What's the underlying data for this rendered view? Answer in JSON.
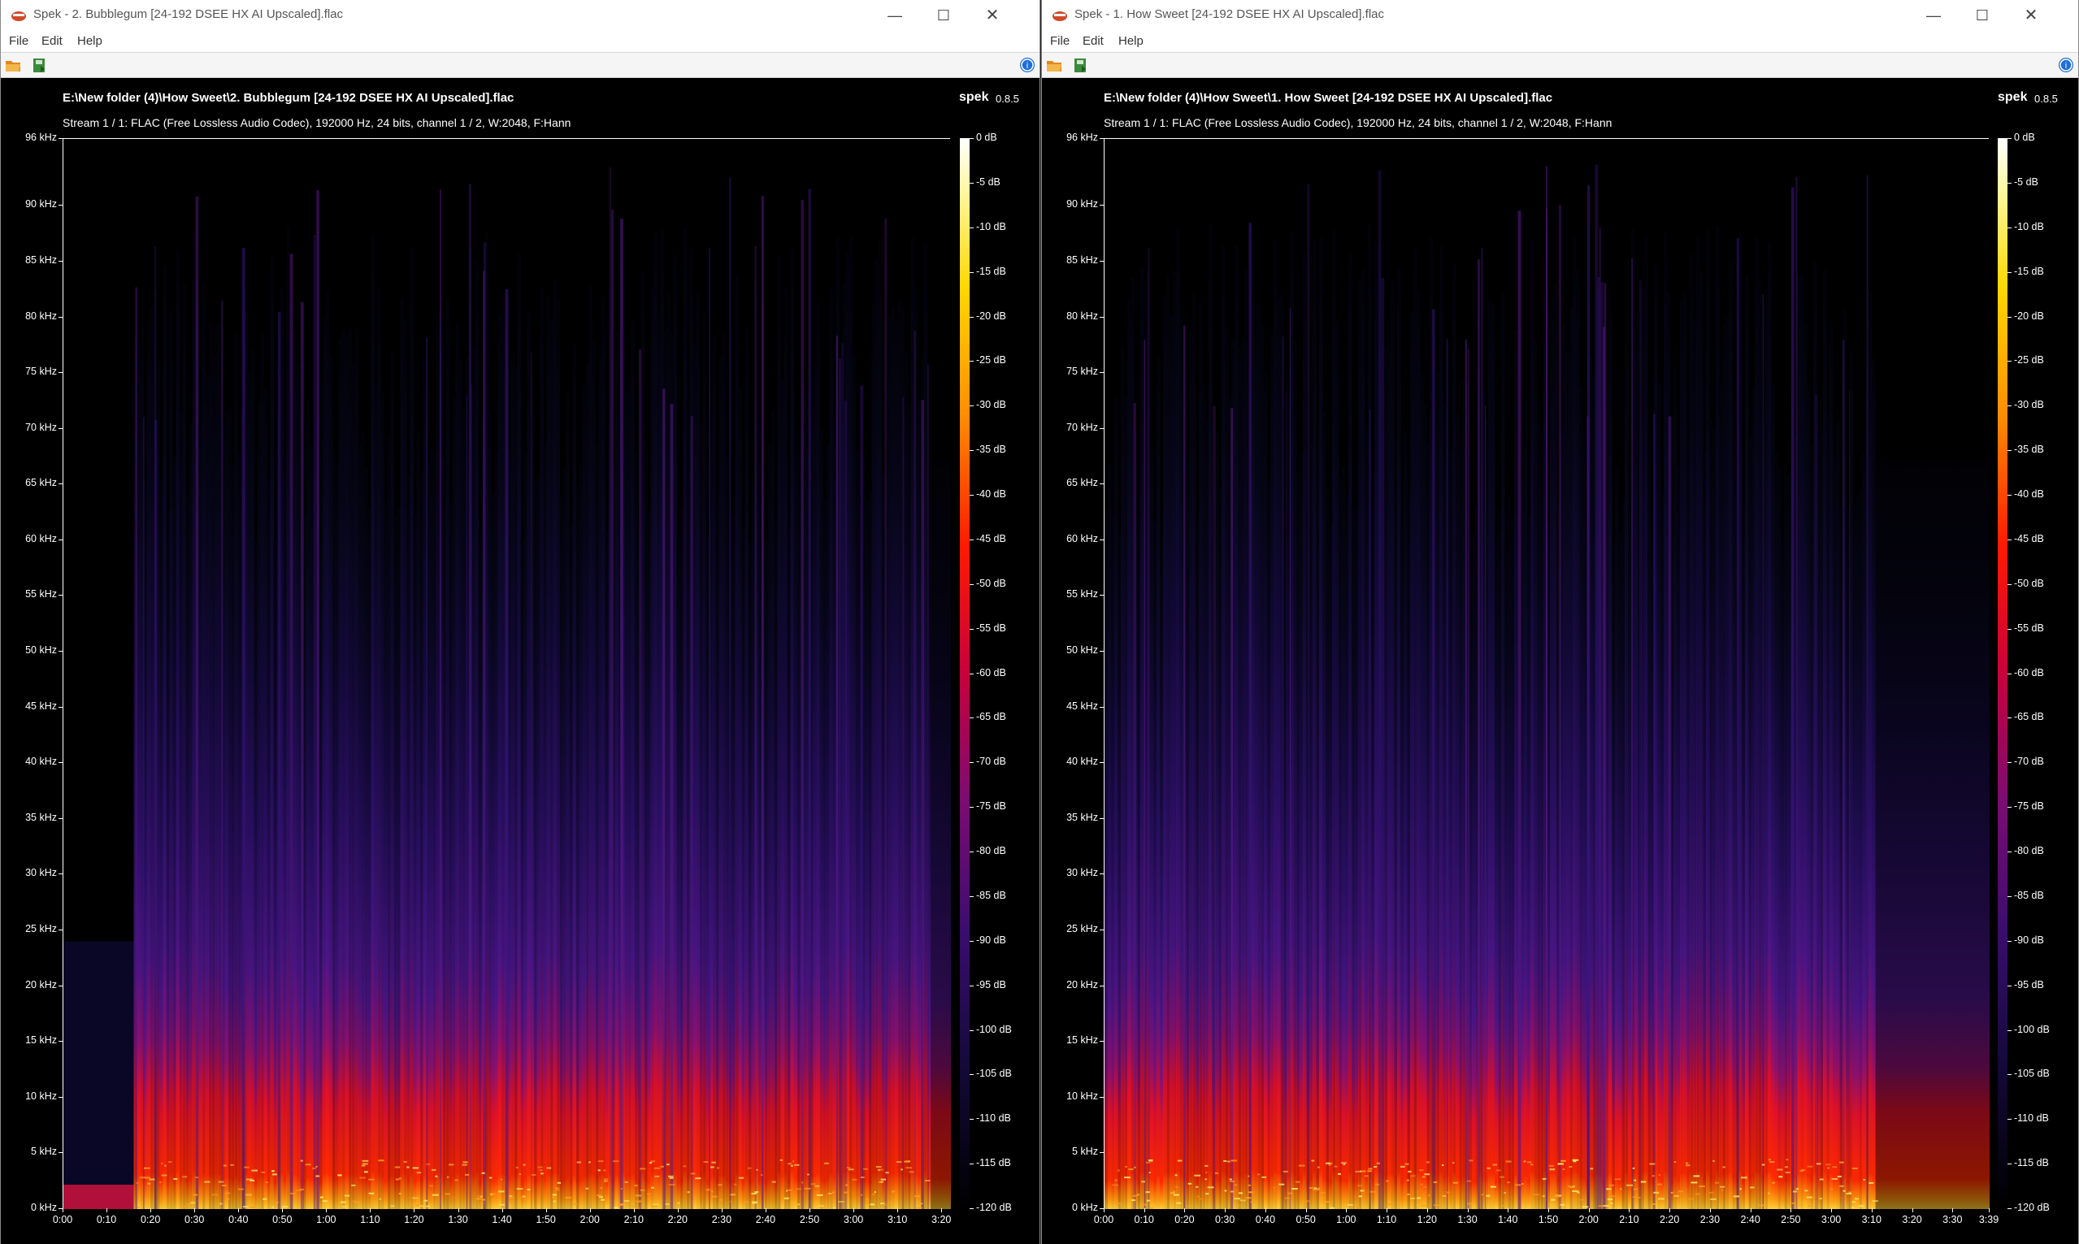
{
  "windows": [
    {
      "title": "Spek - 2. Bubblegum [24-192 DSEE HX AI Upscaled].flac",
      "menu": [
        "File",
        "Edit",
        "Help"
      ],
      "file_title": "E:\\New folder (4)\\How Sweet\\2. Bubblegum [24-192 DSEE HX AI Upscaled].flac",
      "app_name": "spek",
      "app_version": "0.8.5",
      "stream_info": "Stream 1 / 1: FLAC (Free Lossless Audio Codec), 192000 Hz, 24 bits, channel 1 / 2, W:2048, F:Hann",
      "y_labels": [
        "96 kHz",
        "90 kHz",
        "85 kHz",
        "80 kHz",
        "75 kHz",
        "70 kHz",
        "65 kHz",
        "60 kHz",
        "55 kHz",
        "50 kHz",
        "45 kHz",
        "40 kHz",
        "35 kHz",
        "30 kHz",
        "25 kHz",
        "20 kHz",
        "15 kHz",
        "10 kHz",
        "5 kHz",
        "0 kHz"
      ],
      "x_labels": [
        "0:00",
        "0:10",
        "0:20",
        "0:30",
        "0:40",
        "0:50",
        "1:00",
        "1:10",
        "1:20",
        "1:30",
        "1:40",
        "1:50",
        "2:00",
        "2:10",
        "2:20",
        "2:30",
        "2:40",
        "2:50",
        "3:00",
        "3:10",
        "3:20"
      ],
      "db_labels": [
        "0 dB",
        "-5 dB",
        "-10 dB",
        "-15 dB",
        "-20 dB",
        "-25 dB",
        "-30 dB",
        "-35 dB",
        "-40 dB",
        "-45 dB",
        "-50 dB",
        "-55 dB",
        "-60 dB",
        "-65 dB",
        "-70 dB",
        "-75 dB",
        "-80 dB",
        "-85 dB",
        "-90 dB",
        "-95 dB",
        "-100 dB",
        "-105 dB",
        "-110 dB",
        "-115 dB",
        "-120 dB"
      ]
    },
    {
      "title": "Spek - 1. How Sweet [24-192 DSEE HX AI Upscaled].flac",
      "menu": [
        "File",
        "Edit",
        "Help"
      ],
      "file_title": "E:\\New folder (4)\\How Sweet\\1. How Sweet [24-192 DSEE HX AI Upscaled].flac",
      "app_name": "spek",
      "app_version": "0.8.5",
      "stream_info": "Stream 1 / 1: FLAC (Free Lossless Audio Codec), 192000 Hz, 24 bits, channel 1 / 2, W:2048, F:Hann",
      "y_labels": [
        "96 kHz",
        "90 kHz",
        "85 kHz",
        "80 kHz",
        "75 kHz",
        "70 kHz",
        "65 kHz",
        "60 kHz",
        "55 kHz",
        "50 kHz",
        "45 kHz",
        "40 kHz",
        "35 kHz",
        "30 kHz",
        "25 kHz",
        "20 kHz",
        "15 kHz",
        "10 kHz",
        "5 kHz",
        "0 kHz"
      ],
      "x_labels": [
        "0:00",
        "0:10",
        "0:20",
        "0:30",
        "0:40",
        "0:50",
        "1:00",
        "1:10",
        "1:20",
        "1:30",
        "1:40",
        "1:50",
        "2:00",
        "2:10",
        "2:20",
        "2:30",
        "2:40",
        "2:50",
        "3:00",
        "3:10",
        "3:20",
        "3:30",
        "3:39"
      ],
      "db_labels": [
        "0 dB",
        "-5 dB",
        "-10 dB",
        "-15 dB",
        "-20 dB",
        "-25 dB",
        "-30 dB",
        "-35 dB",
        "-40 dB",
        "-45 dB",
        "-50 dB",
        "-55 dB",
        "-60 dB",
        "-65 dB",
        "-70 dB",
        "-75 dB",
        "-80 dB",
        "-85 dB",
        "-90 dB",
        "-95 dB",
        "-100 dB",
        "-105 dB",
        "-110 dB",
        "-115 dB",
        "-120 dB"
      ]
    }
  ],
  "window_controls": [
    "—",
    "☐",
    "✕"
  ],
  "colors": {
    "spectrum_low": "#000000",
    "spectrum_mid": "#3a0d6e",
    "spectrum_high": "#ff1a00",
    "spectrum_peak": "#ffd700"
  }
}
